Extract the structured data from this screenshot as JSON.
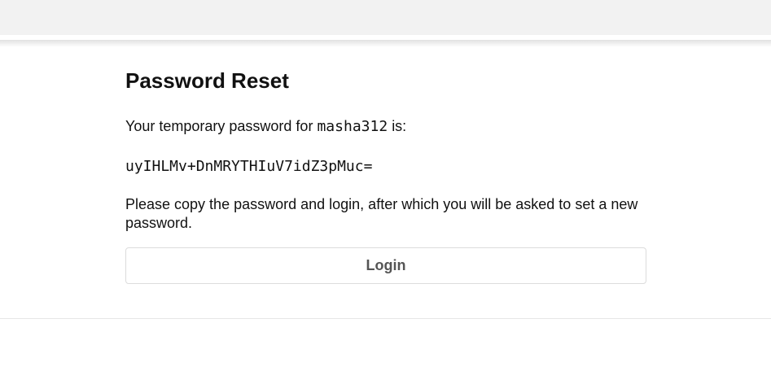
{
  "page": {
    "title": "Password Reset",
    "intro_prefix": "Your temporary password for",
    "username": "masha312",
    "intro_suffix": "is:",
    "temporary_password": "uyIHLMv+DnMRYTHIuV7idZ3pMuc=",
    "instructions": "Please copy the password and login, after which you will be asked to set a new password.",
    "login_label": "Login"
  }
}
